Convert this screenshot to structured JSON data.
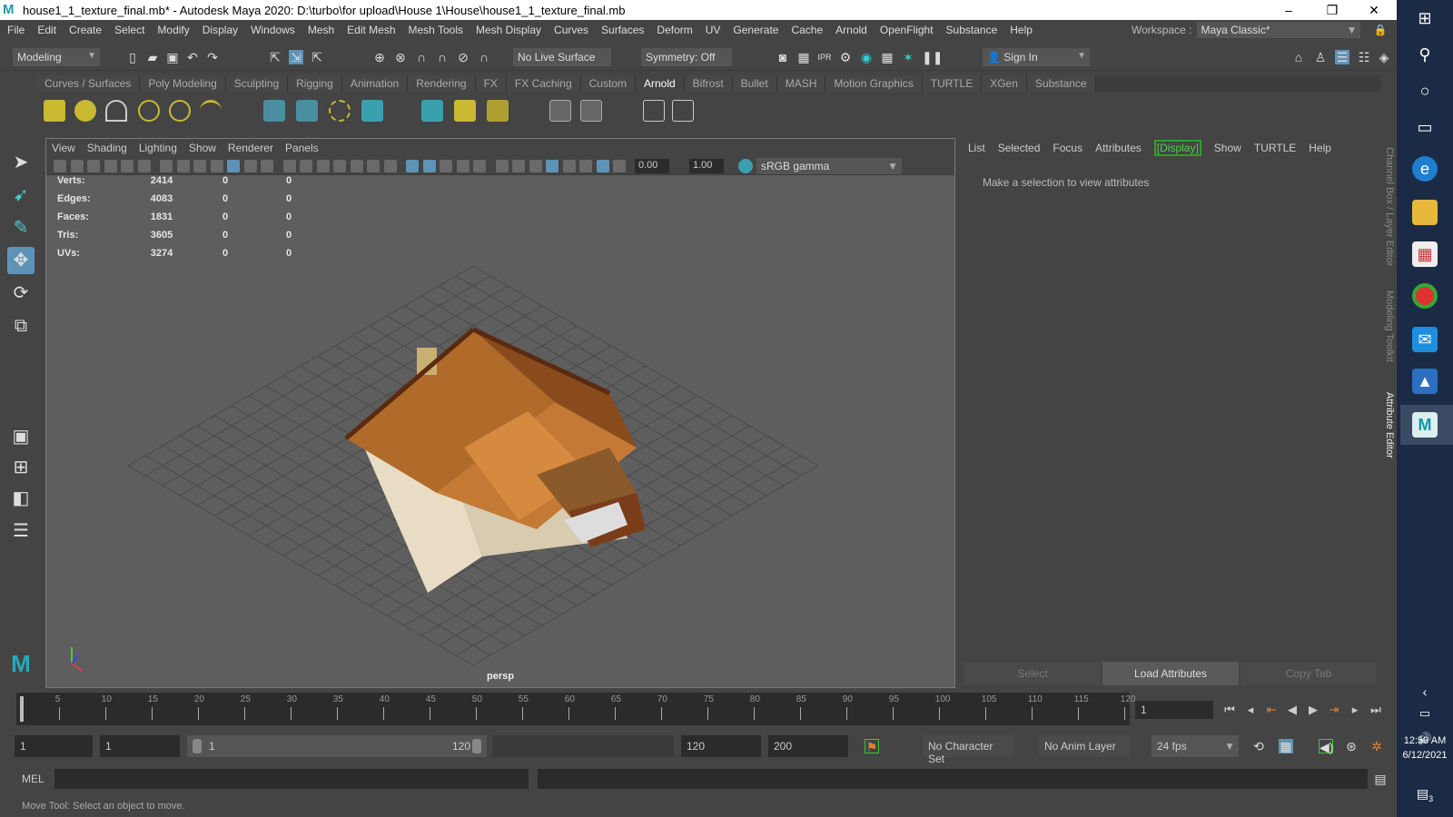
{
  "window": {
    "title": "house1_1_texture_final.mb* - Autodesk Maya 2020: D:\\turbo\\for upload\\House 1\\House\\house1_1_texture_final.mb",
    "logo": "M",
    "minimize": "–",
    "maximize": "❐",
    "close": "✕"
  },
  "menu": [
    "File",
    "Edit",
    "Create",
    "Select",
    "Modify",
    "Display",
    "Windows",
    "Mesh",
    "Edit Mesh",
    "Mesh Tools",
    "Mesh Display",
    "Curves",
    "Surfaces",
    "Deform",
    "UV",
    "Generate",
    "Cache",
    "Arnold",
    "OpenFlight",
    "Substance",
    "Help"
  ],
  "workspace": {
    "label": "Workspace :",
    "value": "Maya Classic*"
  },
  "statusline": {
    "menuset": "Modeling",
    "live_surface": "No Live Surface",
    "symmetry": "Symmetry: Off",
    "sign_in": "Sign In"
  },
  "shelf": {
    "tabs": [
      "Curves / Surfaces",
      "Poly Modeling",
      "Sculpting",
      "Rigging",
      "Animation",
      "Rendering",
      "FX",
      "FX Caching",
      "Custom",
      "Arnold",
      "Bifrost",
      "Bullet",
      "MASH",
      "Motion Graphics",
      "TURTLE",
      "XGen",
      "Substance"
    ],
    "active": "Arnold"
  },
  "viewport": {
    "menu": [
      "View",
      "Shading",
      "Lighting",
      "Show",
      "Renderer",
      "Panels"
    ],
    "exposure": "0.00",
    "gamma": "1.00",
    "colorspace": "sRGB gamma",
    "camera": "persp",
    "hud": [
      {
        "label": "Verts:",
        "a": "2414",
        "b": "0",
        "c": "0"
      },
      {
        "label": "Edges:",
        "a": "4083",
        "b": "0",
        "c": "0"
      },
      {
        "label": "Faces:",
        "a": "1831",
        "b": "0",
        "c": "0"
      },
      {
        "label": "Tris:",
        "a": "3605",
        "b": "0",
        "c": "0"
      },
      {
        "label": "UVs:",
        "a": "3274",
        "b": "0",
        "c": "0"
      }
    ]
  },
  "attribute_editor": {
    "menu": [
      "List",
      "Selected",
      "Focus",
      "Attributes",
      "[Display]",
      "Show",
      "TURTLE",
      "Help"
    ],
    "message": "Make a selection to view attributes",
    "buttons": {
      "select": "Select",
      "load": "Load Attributes",
      "copy": "Copy Tab"
    },
    "side_tabs": [
      "Channel Box / Layer Editor",
      "Modeling Toolkit",
      "Attribute Editor"
    ]
  },
  "timeline": {
    "ticks": [
      5,
      10,
      15,
      20,
      25,
      30,
      35,
      40,
      45,
      50,
      55,
      60,
      65,
      70,
      75,
      80,
      85,
      90,
      95,
      100,
      105,
      110,
      115,
      120
    ],
    "current_frame": "1"
  },
  "range": {
    "start": "1",
    "range_start": "1",
    "slider_start": "1",
    "slider_end": "120",
    "range_end": "120",
    "end": "200",
    "character_set": "No Character Set",
    "anim_layer": "No Anim Layer",
    "fps": "24 fps"
  },
  "command": {
    "lang": "MEL"
  },
  "help_line": "Move Tool: Select an object to move.",
  "taskbar": {
    "time": "12:59 AM",
    "date": "6/12/2021",
    "notifications": "3"
  }
}
